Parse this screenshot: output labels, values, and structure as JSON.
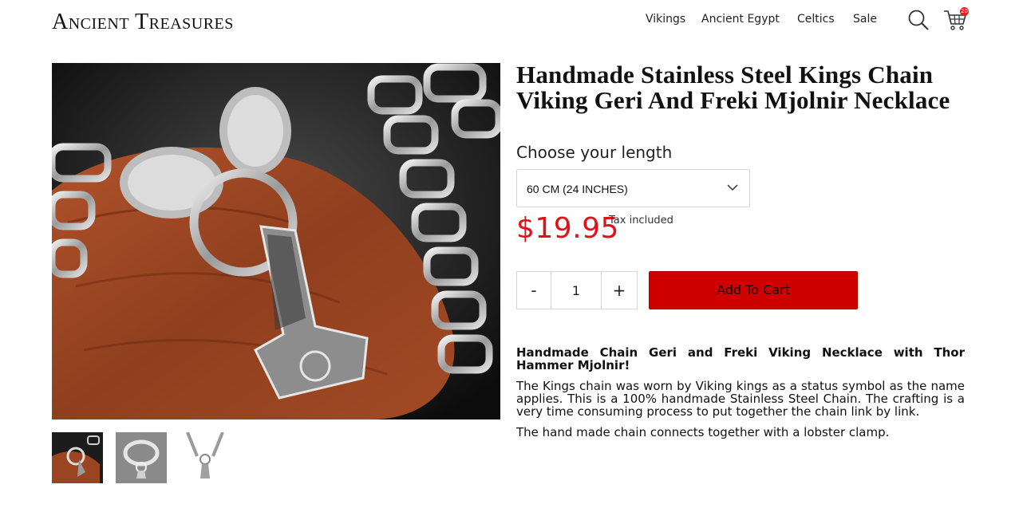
{
  "header": {
    "logo": "Ancient Treasures",
    "nav": [
      {
        "label": "Vikings"
      },
      {
        "label": "Ancient Egypt"
      },
      {
        "label": "Celtics"
      },
      {
        "label": "Sale"
      }
    ],
    "cart_count": "20",
    "icons": [
      "search-icon",
      "cart-icon"
    ]
  },
  "product": {
    "title": "Handmade Stainless Steel Kings Chain Viking Geri And Freki Mjolnir Necklace",
    "length_label": "Choose your length",
    "length_selected": "60 CM (24 INCHES)",
    "price": "$19.95",
    "tax_note": "Tax included",
    "quantity": "1",
    "minus_label": "-",
    "plus_label": "+",
    "add_to_cart_label": "Add To Cart",
    "description_heading": "Handmade Chain Geri and Freki Viking Necklace with Thor Hammer Mjolnir!",
    "description_p1": "The Kings chain was worn by Viking kings as a status symbol as the name applies. This is a 100% handmade Stainless Steel Chain. The crafting is a very time consuming process to put together the chain link by link.",
    "description_p2": "The hand made chain connects together with a lobster clamp."
  },
  "colors": {
    "price": "#e1111a",
    "button": "#cf0000",
    "badge": "#e02020"
  }
}
